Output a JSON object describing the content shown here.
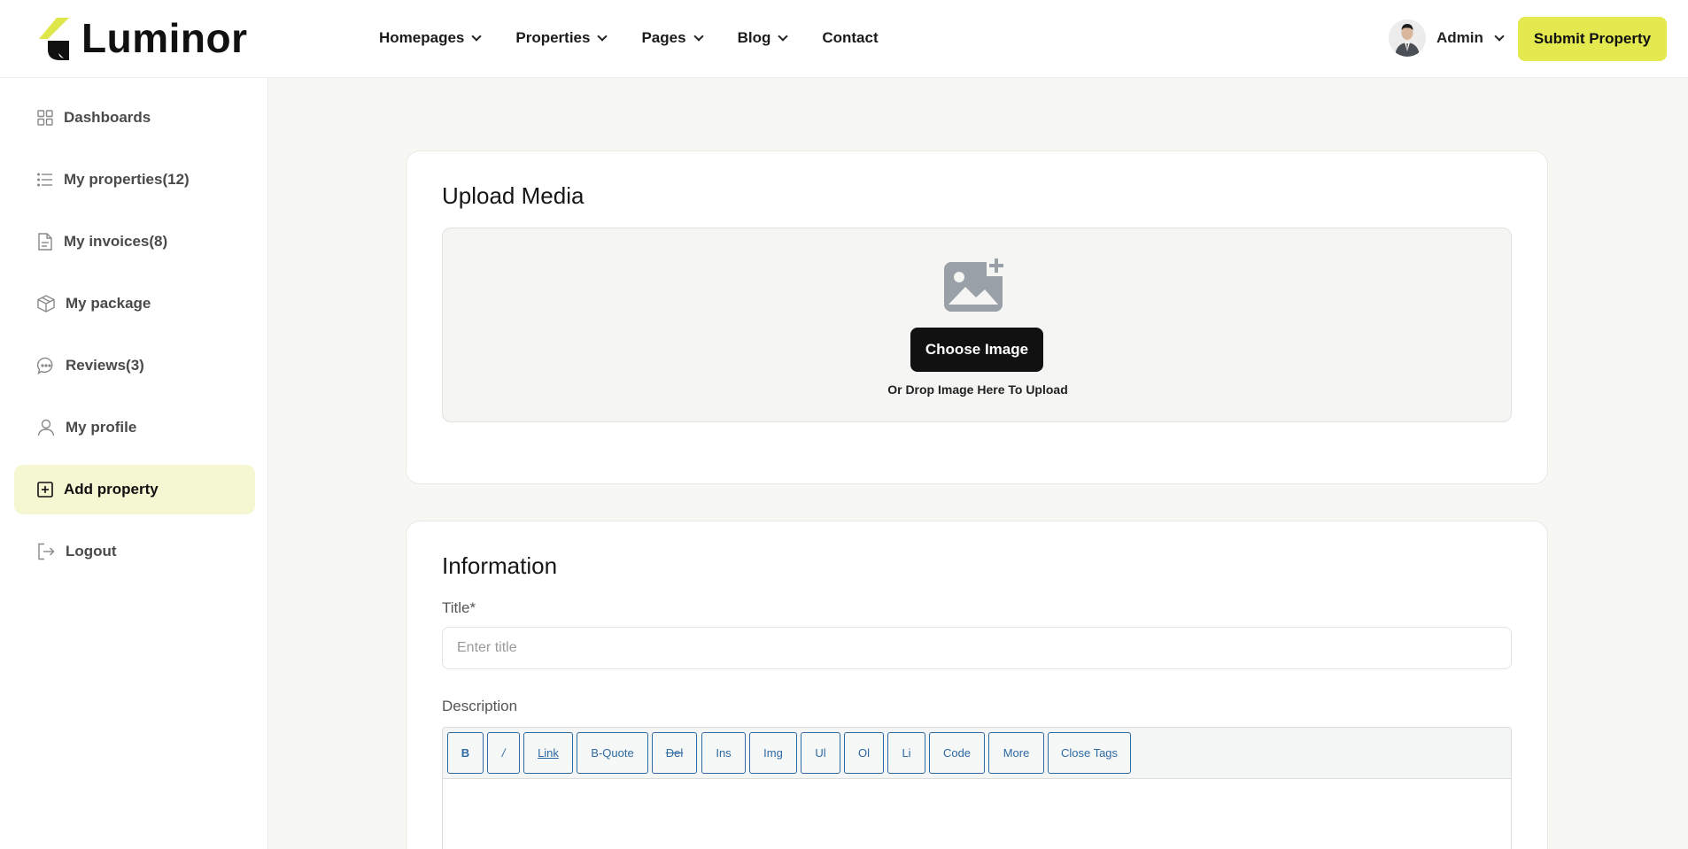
{
  "header": {
    "brand": "Luminor",
    "nav": [
      {
        "label": "Homepages",
        "has_dropdown": true
      },
      {
        "label": "Properties",
        "has_dropdown": true
      },
      {
        "label": "Pages",
        "has_dropdown": true
      },
      {
        "label": "Blog",
        "has_dropdown": true
      },
      {
        "label": "Contact",
        "has_dropdown": false
      }
    ],
    "user_name": "Admin",
    "submit_label": "Submit Property",
    "accent_color": "#e3e94e"
  },
  "sidebar": {
    "items": [
      {
        "label": "Dashboards",
        "icon": "grid-icon"
      },
      {
        "label": "My properties(12)",
        "icon": "list-icon"
      },
      {
        "label": "My invoices(8)",
        "icon": "document-icon"
      },
      {
        "label": "My package",
        "icon": "box-icon"
      },
      {
        "label": "Reviews(3)",
        "icon": "chat-icon"
      },
      {
        "label": "My profile",
        "icon": "user-icon"
      },
      {
        "label": "Add property",
        "icon": "plus-square-icon",
        "active": true
      },
      {
        "label": "Logout",
        "icon": "logout-icon"
      }
    ]
  },
  "upload": {
    "title": "Upload Media",
    "button_label": "Choose Image",
    "hint": "Or Drop Image Here To Upload"
  },
  "information": {
    "title": "Information",
    "title_label": "Title*",
    "title_placeholder": "Enter title",
    "description_label": "Description",
    "toolbar_buttons": [
      "B",
      "/",
      "Link",
      "B-Quote",
      "Del",
      "Ins",
      "Img",
      "Ul",
      "Ol",
      "Li",
      "Code",
      "More",
      "Close Tags"
    ]
  }
}
